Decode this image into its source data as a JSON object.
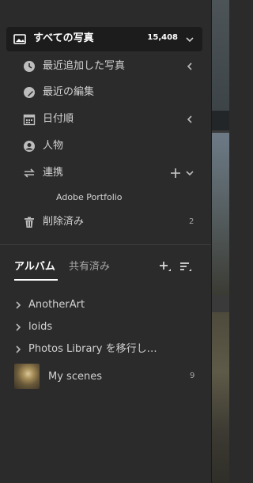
{
  "library": {
    "all_photos": {
      "label": "すべての写真",
      "count": "15,408"
    },
    "items": [
      {
        "label": "最近追加した写真",
        "icon": "clock-icon"
      },
      {
        "label": "最近の編集",
        "icon": "edit-recent-icon"
      },
      {
        "label": "日付順",
        "icon": "calendar-icon"
      },
      {
        "label": "人物",
        "icon": "person-icon"
      },
      {
        "label": "連携",
        "icon": "sync-icon"
      },
      {
        "label": "Adobe Portfolio"
      },
      {
        "label": "削除済み",
        "icon": "trash-icon",
        "count": "2"
      }
    ]
  },
  "albums": {
    "tabs": [
      {
        "label": "アルバム"
      },
      {
        "label": "共有済み"
      }
    ],
    "items": [
      {
        "label": "AnotherArt"
      },
      {
        "label": "loids"
      },
      {
        "label": "Photos Library を移行し…"
      },
      {
        "label": "My scenes",
        "count": "9"
      }
    ]
  }
}
